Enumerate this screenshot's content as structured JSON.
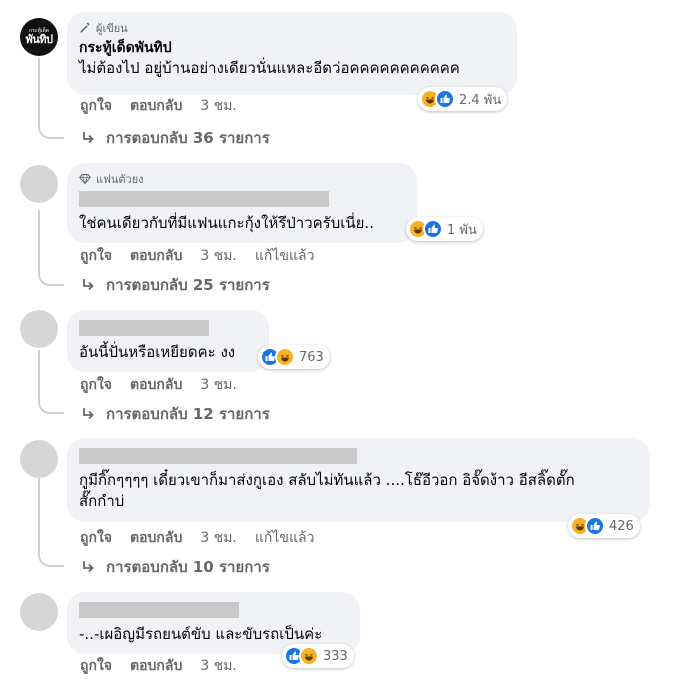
{
  "comments": [
    {
      "badge": "ผู้เขียน",
      "name": "กระทู้เด็ดพันทิป",
      "text": "ไม่ต้องไป อยู่บ้านอย่างเดียวนั่นแหละอีดว่อคคคคคคคคคคค",
      "reaction_count": "2.4 พัน",
      "actions": {
        "like": "ถูกใจ",
        "reply": "ตอบกลับ",
        "time": "3 ชม."
      },
      "replies": "การตอบกลับ 36 รายการ",
      "avatar_logo": {
        "line1": "กระทู้เด็ด",
        "line2": "พันทิป"
      }
    },
    {
      "badge": "แฟนตัวยง",
      "text": "ใช่คนเดียวกับที่มีแฟนแกะกุ้งให้รึป่าวครับเนี่ย..",
      "reaction_count": "1 พัน",
      "actions": {
        "like": "ถูกใจ",
        "reply": "ตอบกลับ",
        "time": "3 ชม.",
        "edited": "แก้ไขแล้ว"
      },
      "replies": "การตอบกลับ 25 รายการ"
    },
    {
      "text": "อันนี้ปั่นหรือเหยียดคะ งง",
      "reaction_count": "763",
      "actions": {
        "like": "ถูกใจ",
        "reply": "ตอบกลับ",
        "time": "3 ชม."
      },
      "replies": "การตอบกลับ 12 รายการ"
    },
    {
      "text_line1": "กูมีกิ๊กๆๆๆๆ เดี๋ยวเขาก็มาส่งกูเอง สลับไม่ทันแล้ว ....โธ๊อีวอก อิจั๊ดง้าว อีสลิ๊ดตั๊ก",
      "text_line2": "สั๊กกำบ่",
      "reaction_count": "426",
      "actions": {
        "like": "ถูกใจ",
        "reply": "ตอบกลับ",
        "time": "3 ชม.",
        "edited": "แก้ไขแล้ว"
      },
      "replies": "การตอบกลับ 10 รายการ"
    },
    {
      "text": "-..-เผอิญมีรถยนต์ขับ และขับรถเป็นค่ะ",
      "reaction_count": "333",
      "actions": {
        "like": "ถูกใจ",
        "reply": "ตอบกลับ",
        "time": "3 ชม."
      }
    }
  ],
  "colors": {
    "bubble_bg": "#f0f2f5",
    "secondary_text": "#65676b",
    "like_blue": "#1b74e4",
    "haha_yellow": "#f7b125"
  },
  "icons": [
    "pencil-icon",
    "diamond-icon",
    "reply-arrow-icon",
    "haha-reaction-icon",
    "like-reaction-icon"
  ]
}
